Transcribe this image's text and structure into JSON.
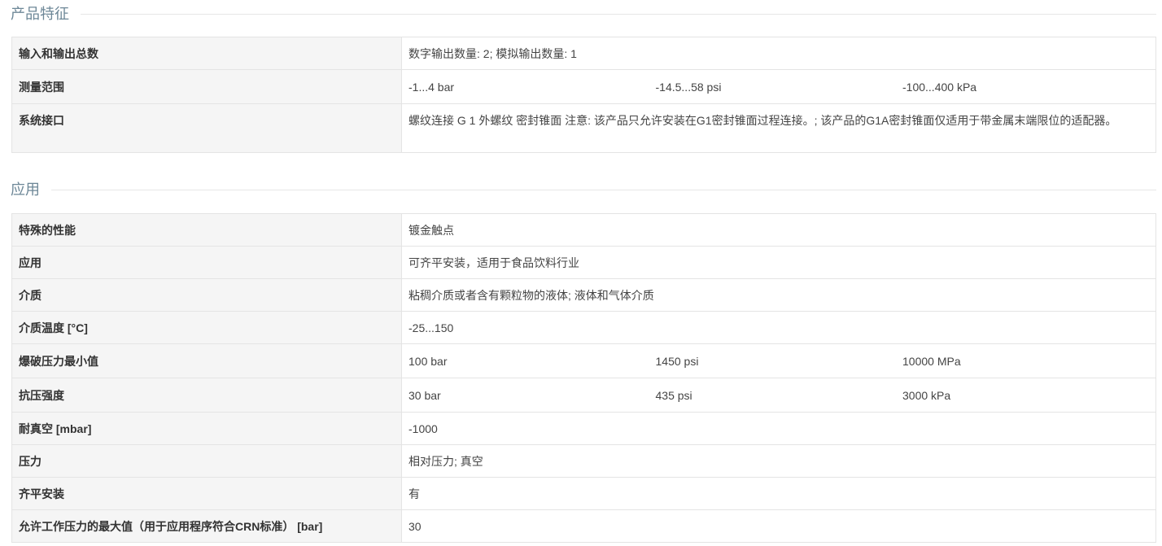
{
  "sections": [
    {
      "title": "产品特征",
      "rows": [
        {
          "label": "输入和输出总数",
          "values": [
            "数字输出数量: 2; 模拟输出数量: 1"
          ]
        },
        {
          "label": "测量范围",
          "values": [
            "-1...4 bar",
            "-14.5...58 psi",
            "-100...400 kPa"
          ]
        },
        {
          "label": "系统接口",
          "values": [
            "螺纹连接 G 1 外螺纹 密封锥面 注意: 该产品只允许安装在G1密封锥面过程连接。; 该产品的G1A密封锥面仅适用于带金属末端限位的适配器。"
          ]
        }
      ]
    },
    {
      "title": "应用",
      "rows": [
        {
          "label": "特殊的性能",
          "values": [
            "镀金触点"
          ]
        },
        {
          "label": "应用",
          "values": [
            "可齐平安装，适用于食品饮料行业"
          ]
        },
        {
          "label": "介质",
          "values": [
            "粘稠介质或者含有颗粒物的液体; 液体和气体介质"
          ]
        },
        {
          "label": "介质温度 [°C]",
          "values": [
            "-25...150"
          ]
        },
        {
          "label": "爆破压力最小值",
          "values": [
            "100 bar",
            "1450 psi",
            "10000 MPa"
          ]
        },
        {
          "label": "抗压强度",
          "values": [
            "30 bar",
            "435 psi",
            "3000 kPa"
          ]
        },
        {
          "label": "耐真空 [mbar]",
          "values": [
            "-1000"
          ]
        },
        {
          "label": "压力",
          "values": [
            "相对压力; 真空"
          ]
        },
        {
          "label": "齐平安装",
          "values": [
            "有"
          ]
        },
        {
          "label": "允许工作压力的最大值（用于应用程序符合CRN标准） [bar]",
          "values": [
            "30"
          ]
        }
      ]
    }
  ]
}
